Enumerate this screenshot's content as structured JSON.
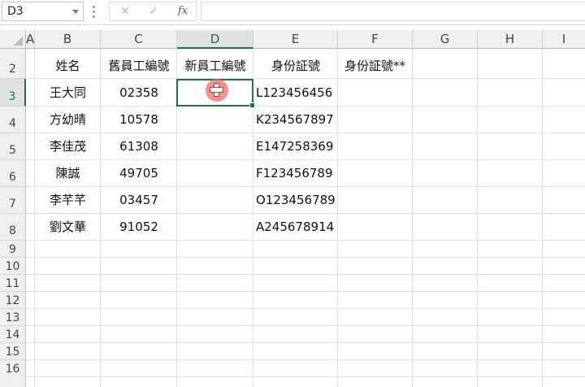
{
  "formula_bar": {
    "name_box": "D3",
    "cancel_icon": "✕",
    "enter_icon": "✓",
    "function_label": "fx",
    "formula_value": ""
  },
  "columns": [
    "A",
    "B",
    "C",
    "D",
    "E",
    "F",
    "G",
    "H",
    "I"
  ],
  "active_column": "D",
  "rows": [
    "2",
    "3",
    "4",
    "5",
    "6",
    "7",
    "8",
    "9",
    "10",
    "11",
    "12",
    "13",
    "14",
    "15",
    "16"
  ],
  "active_row": "3",
  "header_row": {
    "b": "姓名",
    "c": "舊員工編號",
    "d": "新員工編號",
    "e": "身份証號",
    "f": "身份証號**"
  },
  "records": [
    {
      "name": "王大同",
      "old_id": "02358",
      "new_id": "",
      "id_no": "L123456456"
    },
    {
      "name": "方幼晴",
      "old_id": "10578",
      "new_id": "",
      "id_no": "K234567897"
    },
    {
      "name": "李佳茂",
      "old_id": "61308",
      "new_id": "",
      "id_no": "E147258369"
    },
    {
      "name": "陳誠",
      "old_id": "49705",
      "new_id": "",
      "id_no": "F123456789"
    },
    {
      "name": "李芊芊",
      "old_id": "03457",
      "new_id": "",
      "id_no": "O123456789"
    },
    {
      "name": "劉文華",
      "old_id": "91052",
      "new_id": "",
      "id_no": "A245678914"
    }
  ],
  "theme": {
    "accent": "#217346",
    "cursor": "#f06464"
  },
  "cursor_icon": "excel-plus-cursor"
}
